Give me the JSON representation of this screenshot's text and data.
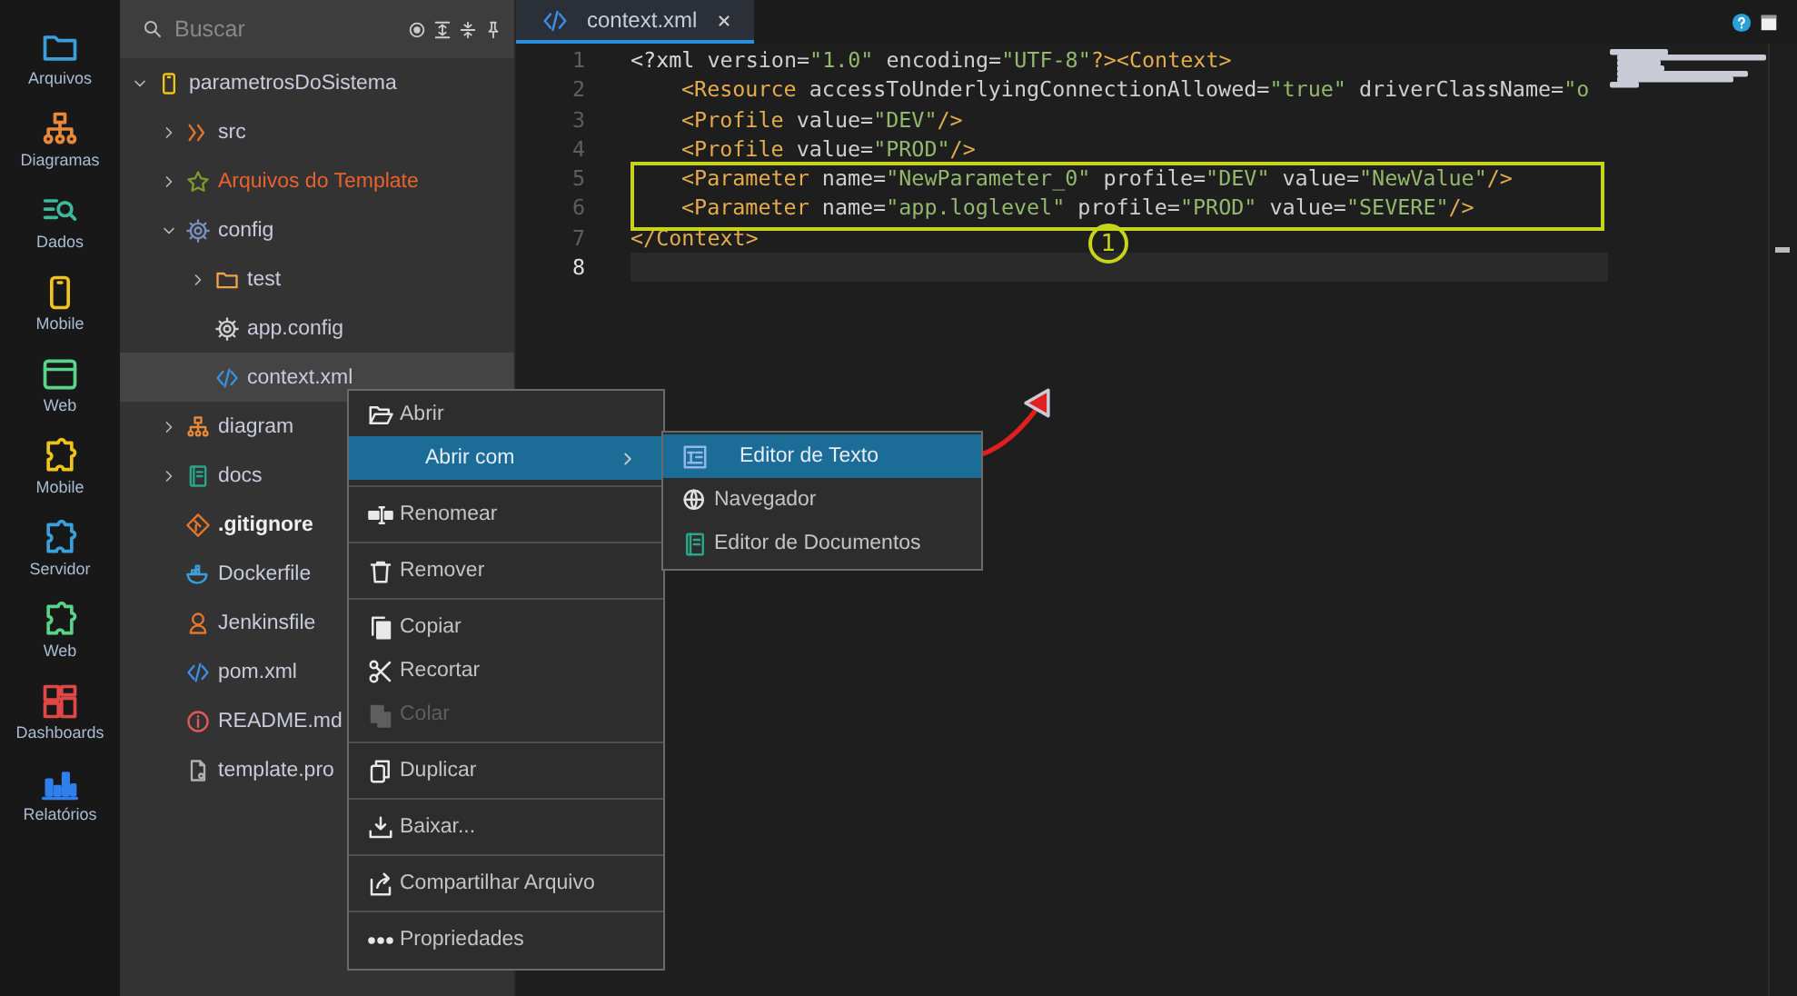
{
  "activity_bar": [
    {
      "label": "Arquivos",
      "kind": "folder",
      "color": "#3aa0dc"
    },
    {
      "label": "Diagramas",
      "kind": "sitemap",
      "color": "#e8893a"
    },
    {
      "label": "Dados",
      "kind": "magnifier",
      "color": "#3cb89a"
    },
    {
      "label": "Mobile",
      "kind": "phone",
      "color": "#f0c419"
    },
    {
      "label": "Web",
      "kind": "browser",
      "color": "#5ad38a"
    },
    {
      "label": "Mobile",
      "kind": "puzzle",
      "color": "#f0c419"
    },
    {
      "label": "Servidor",
      "kind": "puzzle",
      "color": "#3aa0dc"
    },
    {
      "label": "Web",
      "kind": "puzzle",
      "color": "#5ad38a"
    },
    {
      "label": "Dashboards",
      "kind": "dashboard",
      "color": "#e04848"
    },
    {
      "label": "Relatórios",
      "kind": "barchart",
      "color": "#2f80ed"
    }
  ],
  "explorer": {
    "search": {
      "placeholder": "Buscar"
    },
    "tree": [
      {
        "label": "parametrosDoSistema",
        "kind": "project",
        "color": "#f0c419",
        "expanded": true,
        "selected": false,
        "children": [
          {
            "label": "src",
            "kind": "source",
            "color": "#e8762a",
            "expanded": false,
            "selected": false
          },
          {
            "label": "Arquivos do Template",
            "kind": "template",
            "color": "#7a9a2a",
            "expanded": false,
            "selected": false
          },
          {
            "label": "config",
            "kind": "settings",
            "color": "#7a90c0",
            "expanded": true,
            "selected": false,
            "children": [
              {
                "label": "test",
                "kind": "folder",
                "color": "#f0a24a",
                "expanded": false,
                "selected": false
              },
              {
                "label": "app.config",
                "kind": "config",
                "color": "#d0d0d0",
                "selected": false
              },
              {
                "label": "context.xml",
                "kind": "xml",
                "color": "#3a8fe8",
                "selected": true
              }
            ]
          },
          {
            "label": "diagram",
            "kind": "diagram",
            "color": "#e8893a",
            "expanded": false,
            "selected": false
          },
          {
            "label": "docs",
            "kind": "docs",
            "color": "#2aa58a",
            "expanded": false,
            "selected": false
          },
          {
            "label": ".gitignore",
            "kind": "git",
            "color": "#e8762a",
            "selected": false
          },
          {
            "label": "Dockerfile",
            "kind": "docker",
            "color": "#3aa0dc",
            "selected": false
          },
          {
            "label": "Jenkinsfile",
            "kind": "jenkins",
            "color": "#e8762a",
            "selected": false
          },
          {
            "label": "pom.xml",
            "kind": "xml",
            "color": "#3a8fe8",
            "selected": false
          },
          {
            "label": "README.md",
            "kind": "readme",
            "color": "#e05a5a",
            "selected": false
          },
          {
            "label": "template.pro",
            "kind": "properties",
            "color": "#b0b0b0",
            "selected": false
          }
        ]
      }
    ]
  },
  "editor": {
    "tabs": [
      {
        "label": "context.xml",
        "selected": true
      }
    ],
    "lines": [
      {
        "number": "1",
        "indented": false,
        "current": false,
        "boxed": false,
        "tokens": [
          {
            "t": "<?xml",
            "kind": "plain"
          },
          {
            "t": " version=",
            "kind": "attr"
          },
          {
            "t": "\"1.0\"",
            "kind": "value"
          },
          {
            "t": " encoding=",
            "kind": "attr"
          },
          {
            "t": "\"UTF-8\"",
            "kind": "value"
          },
          {
            "t": "?><Context>",
            "kind": "tag"
          }
        ]
      },
      {
        "number": "2",
        "indented": true,
        "current": false,
        "boxed": false,
        "tokens": [
          {
            "t": "<Resource",
            "kind": "tag"
          },
          {
            "t": " accessToUnderlyingConnectionAllowed=",
            "kind": "attr"
          },
          {
            "t": "\"true\"",
            "kind": "value"
          },
          {
            "t": " driverClassName=",
            "kind": "attr"
          },
          {
            "t": "\"o",
            "kind": "value"
          }
        ]
      },
      {
        "number": "3",
        "indented": true,
        "current": false,
        "boxed": false,
        "tokens": [
          {
            "t": "<Profile",
            "kind": "tag"
          },
          {
            "t": " value=",
            "kind": "attr"
          },
          {
            "t": "\"DEV\"",
            "kind": "value"
          },
          {
            "t": "/>",
            "kind": "tag"
          }
        ]
      },
      {
        "number": "4",
        "indented": true,
        "current": false,
        "boxed": false,
        "tokens": [
          {
            "t": "<Profile",
            "kind": "tag"
          },
          {
            "t": " value=",
            "kind": "attr"
          },
          {
            "t": "\"PROD\"",
            "kind": "value"
          },
          {
            "t": "/>",
            "kind": "tag"
          }
        ]
      },
      {
        "number": "5",
        "indented": true,
        "current": false,
        "boxed": true,
        "tokens": [
          {
            "t": "<Parameter",
            "kind": "tag"
          },
          {
            "t": " name=",
            "kind": "attr"
          },
          {
            "t": "\"NewParameter_0\"",
            "kind": "value"
          },
          {
            "t": " profile=",
            "kind": "attr"
          },
          {
            "t": "\"DEV\"",
            "kind": "value"
          },
          {
            "t": " value=",
            "kind": "attr"
          },
          {
            "t": "\"NewValue\"",
            "kind": "value"
          },
          {
            "t": "/>",
            "kind": "tag"
          }
        ]
      },
      {
        "number": "6",
        "indented": true,
        "current": false,
        "boxed": true,
        "tokens": [
          {
            "t": "<Parameter",
            "kind": "tag"
          },
          {
            "t": " name=",
            "kind": "attr"
          },
          {
            "t": "\"app.loglevel\"",
            "kind": "value"
          },
          {
            "t": " profile=",
            "kind": "attr"
          },
          {
            "t": "\"PROD\"",
            "kind": "value"
          },
          {
            "t": " value=",
            "kind": "attr"
          },
          {
            "t": "\"SEVERE\"",
            "kind": "value"
          },
          {
            "t": "/>",
            "kind": "tag"
          }
        ]
      },
      {
        "number": "7",
        "indented": false,
        "current": false,
        "boxed": false,
        "tokens": [
          {
            "t": "</Context>",
            "kind": "tag"
          }
        ]
      },
      {
        "number": "8",
        "indented": false,
        "current": true,
        "boxed": false
      }
    ],
    "callout": "1"
  },
  "context_menu": {
    "items": [
      {
        "kind": "item",
        "label": "Abrir",
        "selected": false,
        "disabled": false
      },
      {
        "kind": "submenu",
        "label": "Abrir com",
        "selected": true,
        "disabled": false
      },
      {
        "kind": "separator"
      },
      {
        "kind": "item",
        "label": "Renomear",
        "selected": false,
        "disabled": false
      },
      {
        "kind": "separator"
      },
      {
        "kind": "item",
        "label": "Remover",
        "selected": false,
        "disabled": false
      },
      {
        "kind": "separator"
      },
      {
        "kind": "item",
        "label": "Copiar",
        "selected": false,
        "disabled": false
      },
      {
        "kind": "item",
        "label": "Recortar",
        "selected": false,
        "disabled": false
      },
      {
        "kind": "item",
        "label": "Colar",
        "selected": false,
        "disabled": true
      },
      {
        "kind": "separator"
      },
      {
        "kind": "item",
        "label": "Duplicar",
        "selected": false,
        "disabled": false
      },
      {
        "kind": "separator"
      },
      {
        "kind": "item",
        "label": "Baixar...",
        "selected": false,
        "disabled": false
      },
      {
        "kind": "separator"
      },
      {
        "kind": "item",
        "label": "Compartilhar Arquivo",
        "selected": false,
        "disabled": false
      },
      {
        "kind": "separator"
      },
      {
        "kind": "item",
        "label": "Propriedades",
        "selected": false,
        "disabled": false
      }
    ],
    "submenu": {
      "items": [
        {
          "label": "Editor de Texto",
          "color": "#8fb8e8",
          "selected": true
        },
        {
          "label": "Navegador",
          "color": "#e0e0e0",
          "selected": false
        },
        {
          "label": "Editor de Documentos",
          "color": "#2aa58a",
          "selected": false
        }
      ]
    }
  }
}
